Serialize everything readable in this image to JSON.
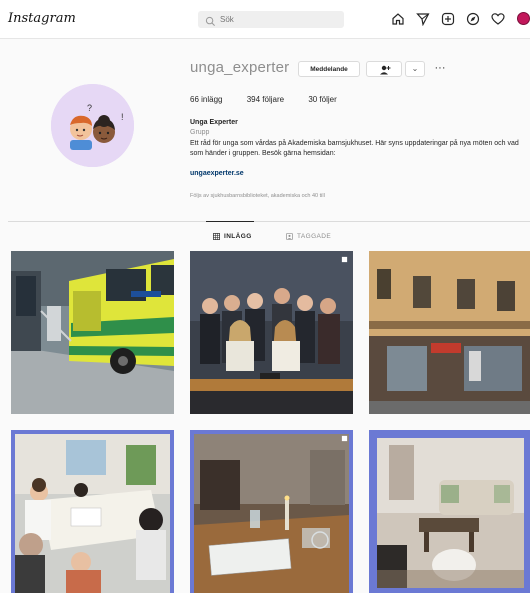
{
  "nav": {
    "logo": "Instagram",
    "search_placeholder": "Sök",
    "icons": [
      "home-icon",
      "direct-icon",
      "new-post-icon",
      "explore-icon",
      "activity-icon",
      "profile-avatar-icon"
    ]
  },
  "profile": {
    "username": "unga_experter",
    "message_label": "Meddelande",
    "more_label": "···",
    "stats": {
      "posts": "66 inlägg",
      "followers": "394 följare",
      "following": "30 följer"
    },
    "full_name": "Unga Experter",
    "category": "Grupp",
    "bio": "Ett råd för unga som vårdas på Akademiska barnsjukhuset. Här syns uppdateringar på nya möten och vad som händer i gruppen. Besök gärna hemsidan:",
    "website": "ungaexperter.se",
    "followed_by": "Följs av sjukhusbarnsbiblioteket, akademiska och 40 till"
  },
  "tabs": [
    {
      "label": "INLÄGG",
      "active": true
    },
    {
      "label": "TAGGADE",
      "active": false
    }
  ],
  "colors": {
    "accent": "#0095f6",
    "tile_frame_blue": "#6b79d4"
  },
  "grid": {
    "posts": [
      {
        "subject": "ambulance-photo"
      },
      {
        "subject": "group-photo"
      },
      {
        "subject": "street-building-photo"
      },
      {
        "subject": "children-table-photo"
      },
      {
        "subject": "meeting-room-photo"
      },
      {
        "subject": "living-room-photo"
      }
    ]
  }
}
